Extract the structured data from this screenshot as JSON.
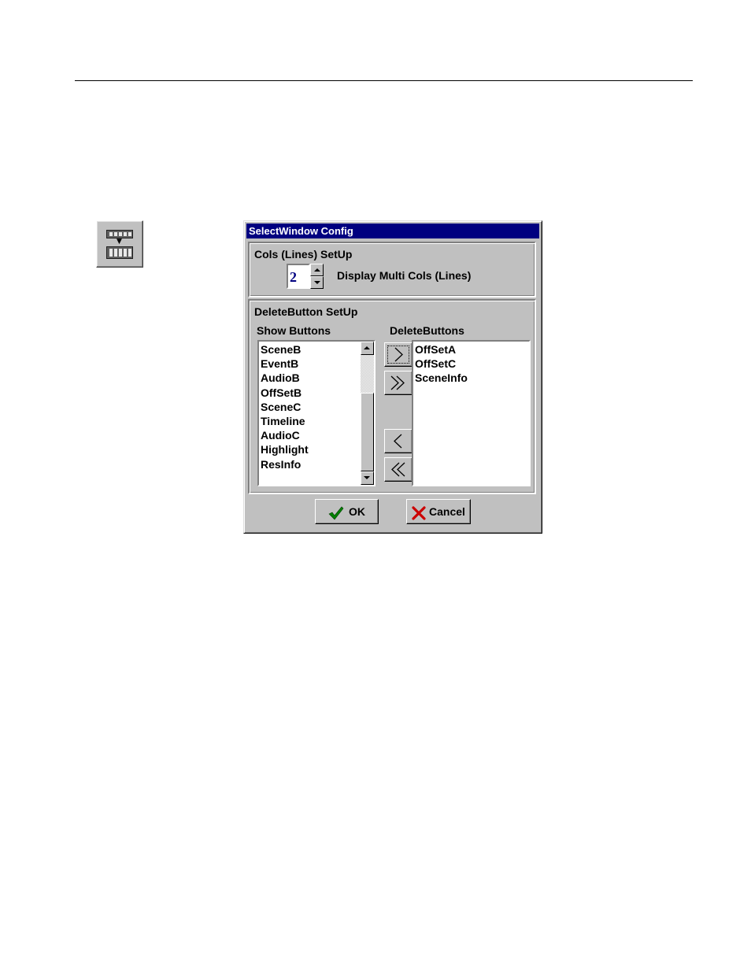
{
  "dialog": {
    "title": "SelectWindow Config",
    "cols_group": {
      "label": "Cols (Lines) SetUp",
      "spin_value": "2",
      "description": "Display Multi Cols (Lines)"
    },
    "delete_group": {
      "label": "DeleteButton SetUp",
      "show_label": "Show Buttons",
      "delete_label": "DeleteButtons",
      "show_items": [
        "SceneB",
        "EventB",
        "AudioB",
        "OffSetB",
        "SceneC",
        "Timeline",
        "AudioC",
        "Highlight",
        "ResInfo"
      ],
      "delete_items": [
        "OffSetA",
        "OffSetC",
        "SceneInfo"
      ]
    },
    "buttons": {
      "ok": "OK",
      "cancel": "Cancel"
    }
  },
  "colors": {
    "titlebar": "#000080",
    "face": "#c0c0c0",
    "ok_check": "#008000",
    "cancel_x": "#cc0000"
  }
}
